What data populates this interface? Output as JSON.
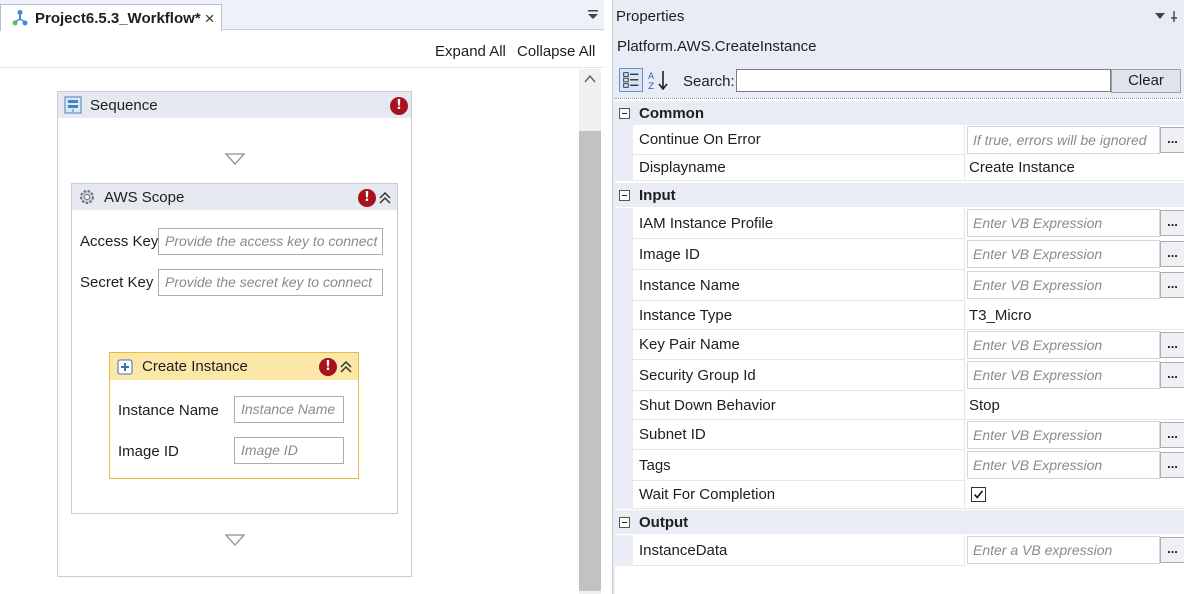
{
  "document_tab": {
    "title": "Project6.5.3_Workflow*",
    "close": "×"
  },
  "designer_toolbar": {
    "expand_all": "Expand All",
    "collapse_all": "Collapse All"
  },
  "sequence": {
    "title": "Sequence"
  },
  "aws_scope": {
    "title": "AWS Scope",
    "access_key_label": "Access Key",
    "access_key_placeholder": "Provide the access key to connect",
    "secret_key_label": "Secret Key",
    "secret_key_placeholder": "Provide the secret key to connect"
  },
  "create_instance": {
    "title": "Create Instance",
    "instance_name_label": "Instance Name",
    "instance_name_placeholder": "Instance Name",
    "image_id_label": "Image ID",
    "image_id_placeholder": "Image ID"
  },
  "properties": {
    "panel_title": "Properties",
    "object_name": "Platform.AWS.CreateInstance",
    "search_label": "Search:",
    "clear_label": "Clear",
    "categories": {
      "common": "Common",
      "input": "Input",
      "output": "Output"
    },
    "common": [
      {
        "name": "Continue On Error",
        "value": "If true, errors will be ignored"
      },
      {
        "name": "Displayname",
        "value": "Create Instance"
      }
    ],
    "input": [
      {
        "name": "IAM Instance Profile",
        "value": "Enter VB Expression"
      },
      {
        "name": "Image ID",
        "value": "Enter VB Expression"
      },
      {
        "name": "Instance Name",
        "value": "Enter VB Expression"
      },
      {
        "name": "Instance Type",
        "value": "T3_Micro"
      },
      {
        "name": "Key Pair Name",
        "value": "Enter VB Expression"
      },
      {
        "name": "Security Group Id",
        "value": "Enter VB Expression"
      },
      {
        "name": "Shut Down Behavior",
        "value": "Stop"
      },
      {
        "name": "Subnet ID",
        "value": "Enter VB Expression"
      },
      {
        "name": "Tags",
        "value": "Enter VB Expression"
      },
      {
        "name": "Wait For Completion",
        "value": ""
      }
    ],
    "output": [
      {
        "name": "InstanceData",
        "value": "Enter a VB expression"
      }
    ],
    "ellipsis": "..."
  },
  "colors": {
    "error_red": "#a8121e",
    "highlight_yellow": "#fbe7a7",
    "panel_bg": "#e9ecf4"
  }
}
